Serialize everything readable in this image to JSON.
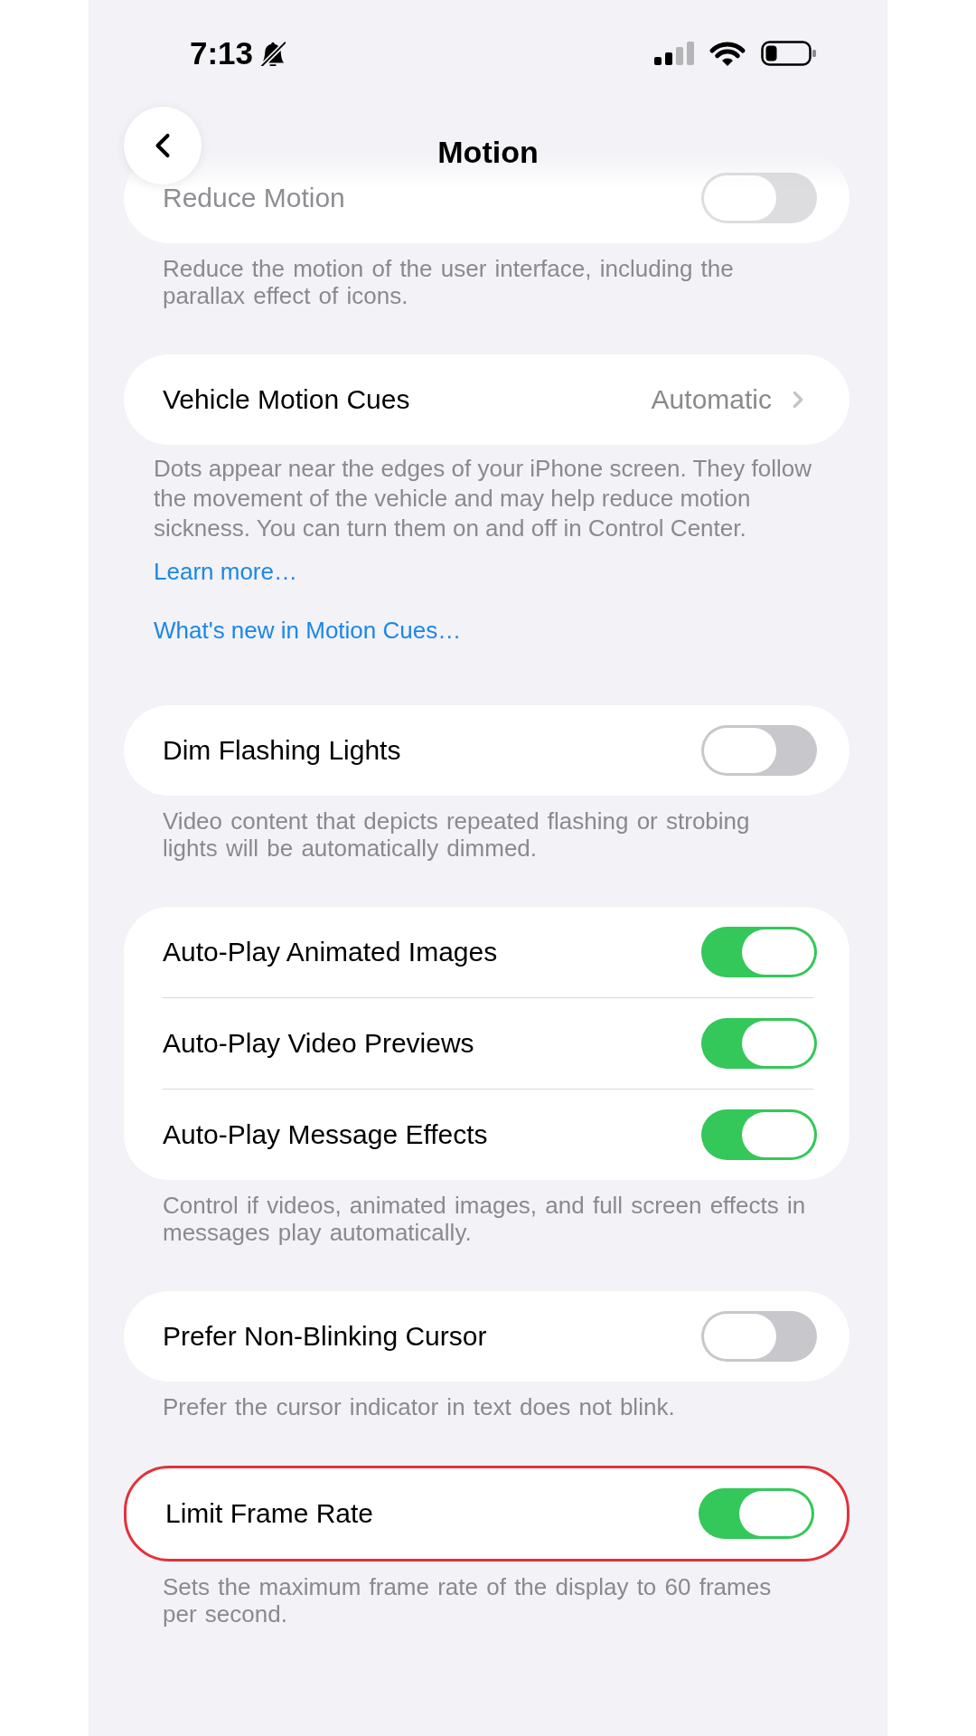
{
  "status_bar": {
    "time": "7:13"
  },
  "nav": {
    "title": "Motion"
  },
  "sections": [
    {
      "faded": true,
      "highlighted": false,
      "rows": [
        {
          "kind": "toggle",
          "label": "Reduce Motion",
          "on": false
        }
      ],
      "footer": "Reduce the motion of the user interface, including the parallax effect of icons."
    },
    {
      "faded": false,
      "highlighted": false,
      "rows": [
        {
          "kind": "link",
          "label": "Vehicle Motion Cues",
          "value": "Automatic"
        }
      ],
      "footer": "Dots appear near the edges of your iPhone screen. They follow the movement of the vehicle and may help reduce motion sickness. You can turn them on and off in Control Center.",
      "links": [
        "Learn more…",
        "What's new in Motion Cues…"
      ]
    },
    {
      "faded": false,
      "highlighted": false,
      "rows": [
        {
          "kind": "toggle",
          "label": "Dim Flashing Lights",
          "on": false
        }
      ],
      "footer": "Video content that depicts repeated flashing or strobing lights will be automatically dimmed."
    },
    {
      "faded": false,
      "highlighted": false,
      "rows": [
        {
          "kind": "toggle",
          "label": "Auto-Play Animated Images",
          "on": true
        },
        {
          "kind": "toggle",
          "label": "Auto-Play Video Previews",
          "on": true
        },
        {
          "kind": "toggle",
          "label": "Auto-Play Message Effects",
          "on": true
        }
      ],
      "footer": "Control if videos, animated images, and full screen effects in messages play automatically."
    },
    {
      "faded": false,
      "highlighted": false,
      "rows": [
        {
          "kind": "toggle",
          "label": "Prefer Non-Blinking Cursor",
          "on": false
        }
      ],
      "footer": "Prefer the cursor indicator in text does not blink."
    },
    {
      "faded": false,
      "highlighted": true,
      "rows": [
        {
          "kind": "toggle",
          "label": "Limit Frame Rate",
          "on": true
        }
      ],
      "footer": "Sets the maximum frame rate of the display to 60 frames per second."
    }
  ]
}
